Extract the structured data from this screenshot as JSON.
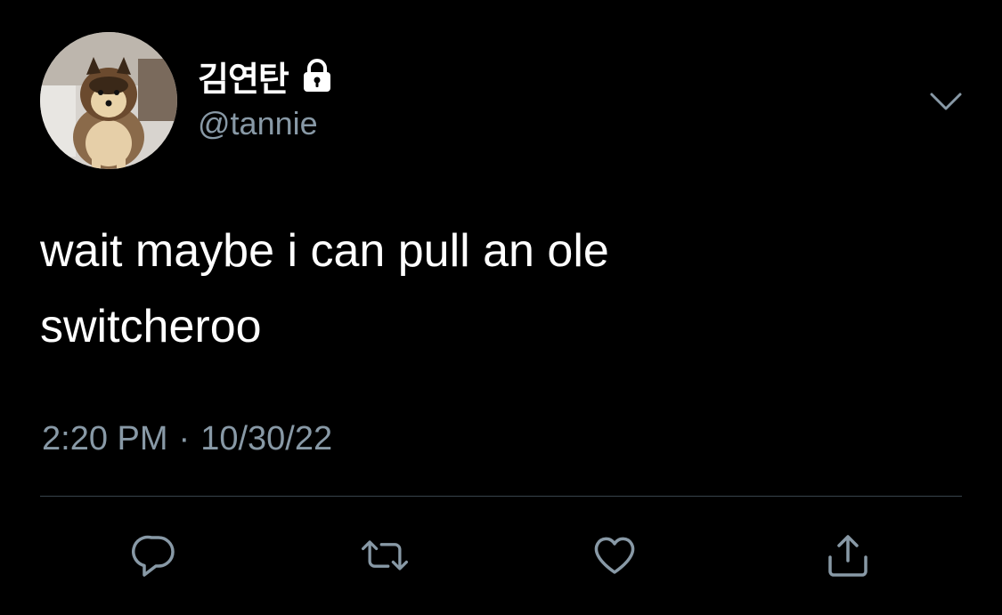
{
  "user": {
    "display_name": "김연탄",
    "handle": "@tannie",
    "avatar_icon": "pomeranian-dog-avatar",
    "protected_icon": "lock-icon"
  },
  "tweet": {
    "text_lines": [
      "wait maybe i can pull an ole",
      "switcheroo"
    ],
    "time": "2:20 PM",
    "separator": "·",
    "date": "10/30/22"
  },
  "actions": {
    "reply_icon": "reply-icon",
    "retweet_icon": "retweet-icon",
    "like_icon": "heart-icon",
    "share_icon": "share-icon"
  },
  "colors": {
    "background": "#000000",
    "text_primary": "#ffffff",
    "text_secondary": "#8899a6",
    "divider": "#38444d"
  }
}
